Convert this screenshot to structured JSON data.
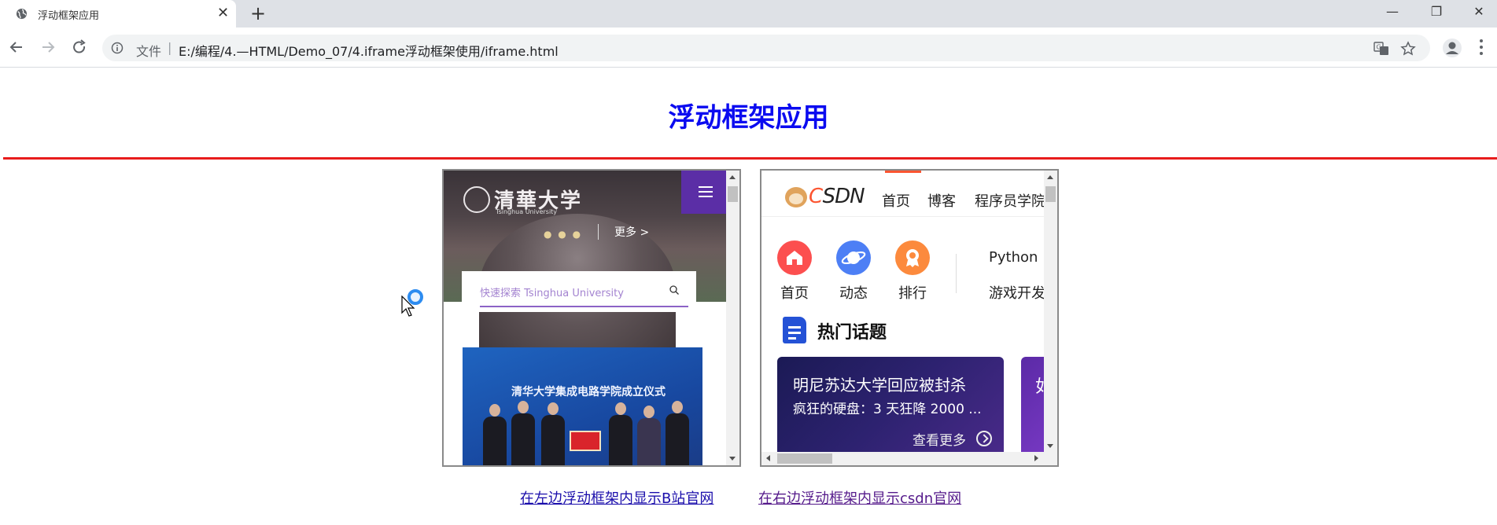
{
  "browser": {
    "tab_title": "浮动框架应用",
    "omnibox": {
      "protocol_label": "文件",
      "separator": "|",
      "url": "E:/编程/4.—HTML/Demo_07/4.iframe浮动框架使用/iframe.html"
    },
    "new_tab_glyph": "+",
    "close_glyph": "✕",
    "window_controls": {
      "minimize": "—",
      "restore": "❐",
      "close": "✕"
    }
  },
  "page": {
    "title": "浮动框架应用",
    "title_color": "#0b0bf0",
    "rule_color": "#e81c1c",
    "links": [
      {
        "label": "在左边浮动框架内显示B站官网"
      },
      {
        "label": "在右边浮动框架内显示csdn官网"
      }
    ]
  },
  "left_iframe": {
    "logo_text": "清華大学",
    "logo_sub": "Tsinghua University",
    "dots": "● ● ●",
    "more": "更多 >",
    "search_placeholder": "快速探索 Tsinghua University",
    "banner_text": "清华大学集成电路学院成立仪式",
    "accent_color": "#5b2ea6"
  },
  "right_iframe": {
    "logo": {
      "c": "C",
      "rest": "SDN"
    },
    "nav": [
      "首页",
      "博客",
      "程序员学院"
    ],
    "shortcuts": [
      {
        "label": "首页",
        "icon": "home-icon",
        "color": "#fc4f4f"
      },
      {
        "label": "动态",
        "icon": "planet-icon",
        "color": "#4d7ff5"
      },
      {
        "label": "排行",
        "icon": "medal-icon",
        "color": "#fc8a3d"
      }
    ],
    "side_items": [
      "Python",
      "游戏开发"
    ],
    "hot_title": "热门话题",
    "card": {
      "line1": "明尼苏达大学回应被封杀",
      "line2": "疯狂的硬盘：3 天狂降 2000 ...",
      "more": "查看更多"
    },
    "card2_glyph": "如"
  }
}
